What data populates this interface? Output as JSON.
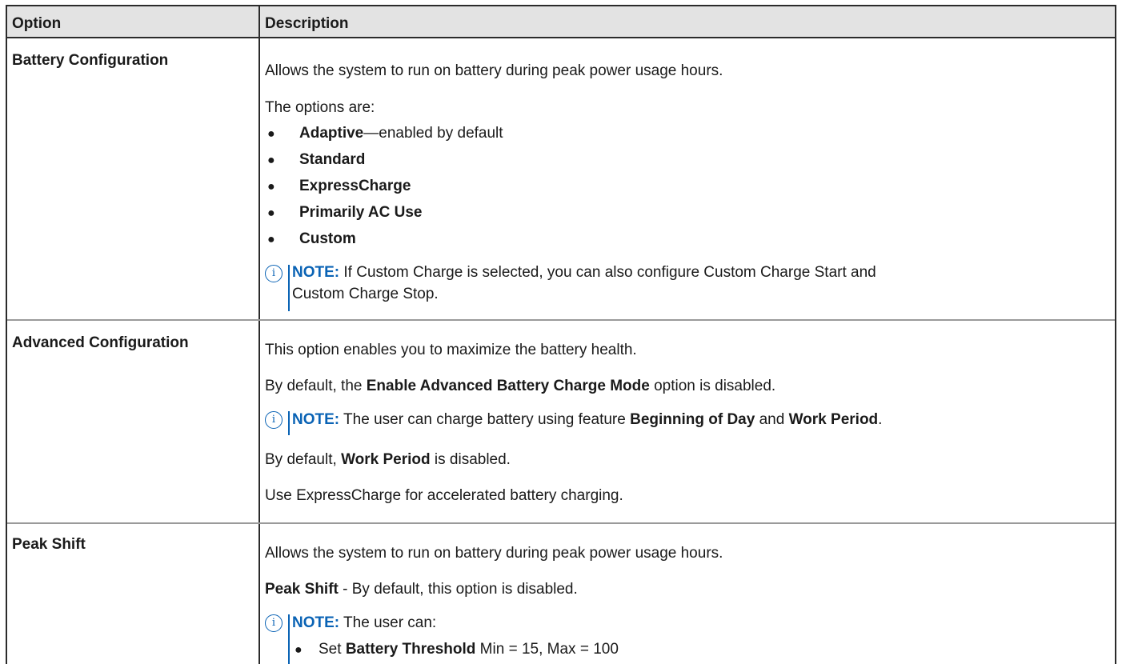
{
  "table": {
    "header": {
      "option": "Option",
      "description": "Description"
    },
    "rows": [
      {
        "option": "Battery Configuration",
        "desc_intro": "Allows the system to run on battery during peak power usage hours.",
        "options_intro": "The options are:",
        "list": [
          {
            "bold": "Adaptive",
            "rest": "—enabled by default"
          },
          {
            "bold": "Standard",
            "rest": ""
          },
          {
            "bold": "ExpressCharge",
            "rest": ""
          },
          {
            "bold": "Primarily AC Use",
            "rest": ""
          },
          {
            "bold": "Custom",
            "rest": ""
          }
        ],
        "note_label": "NOTE:",
        "note_line1": " If Custom Charge is selected, you can also configure Custom Charge Start and",
        "note_line2": "Custom Charge Stop."
      },
      {
        "option": "Advanced Configuration",
        "desc_intro": "This option enables you to maximize the battery health.",
        "p2_pre": "By default, the ",
        "p2_bold": "Enable Advanced Battery Charge Mode",
        "p2_post": " option is disabled.",
        "note_label": "NOTE:",
        "note_pre": " The user can charge battery using feature ",
        "note_bold1": "Beginning of Day",
        "note_mid": " and ",
        "note_bold2": "Work Period",
        "note_post": ".",
        "p3_pre": "By default, ",
        "p3_bold": "Work Period",
        "p3_post": " is disabled.",
        "p4": "Use ExpressCharge for accelerated battery charging."
      },
      {
        "option": "Peak Shift",
        "desc_intro": "Allows the system to run on battery during peak power usage hours.",
        "p2_bold": "Peak Shift",
        "p2_post": " - By default, this option is disabled.",
        "note_label": "NOTE:",
        "note_text": " The user can:",
        "note_bullet_pre": "Set ",
        "note_bullet_bold": "Battery Threshold",
        "note_bullet_post": " Min = 15, Max = 100"
      }
    ]
  },
  "icons": {
    "note": "info-circle-icon",
    "bullet": "bullet-dot-icon"
  },
  "colors": {
    "accent": "#0a63b5",
    "header_bg": "#e3e3e3",
    "border": "#2b2b2b"
  }
}
